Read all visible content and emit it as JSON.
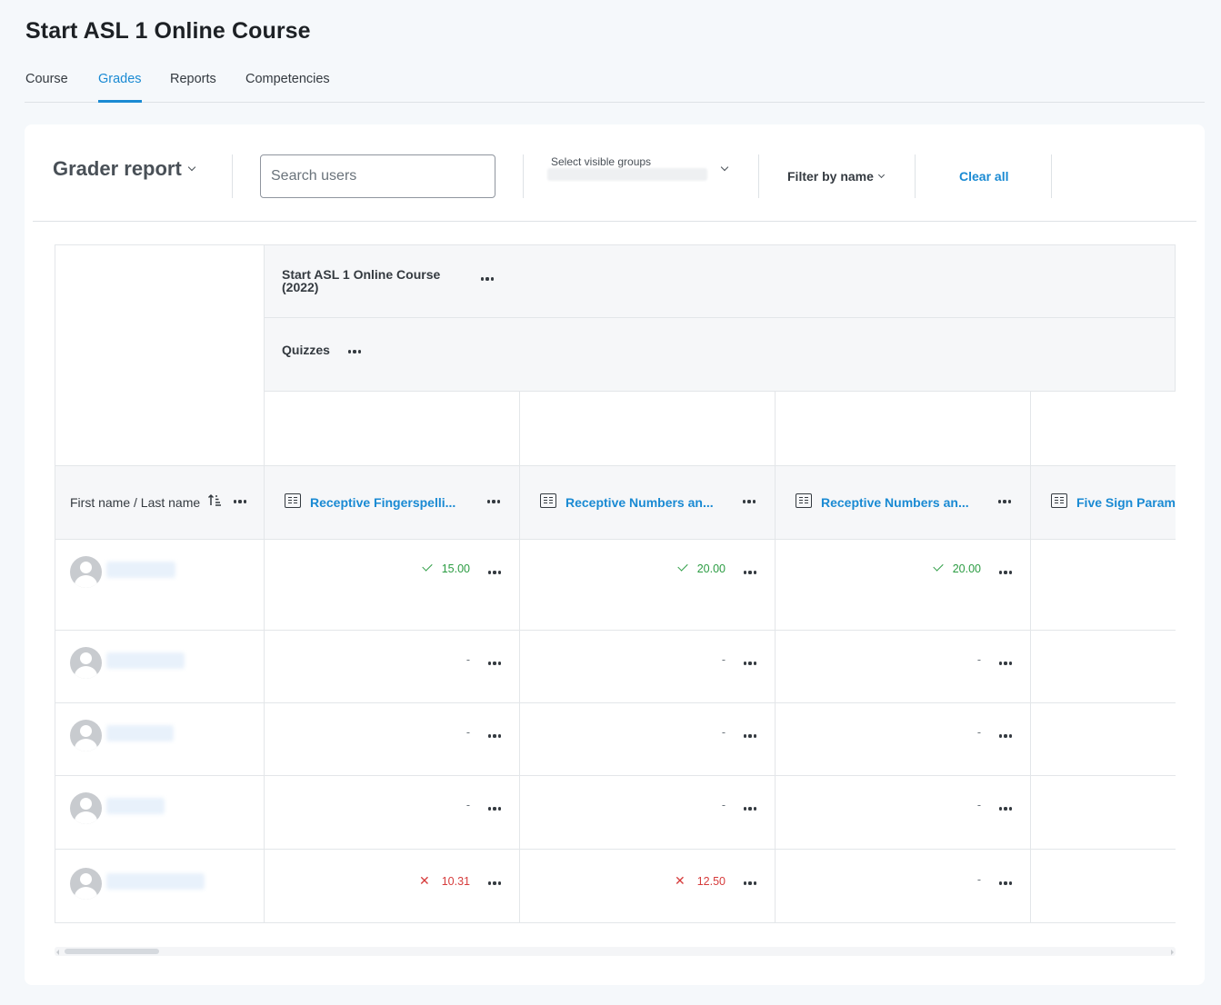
{
  "page": {
    "title": "Start ASL 1 Online Course"
  },
  "tabs": [
    {
      "label": "Course",
      "active": false
    },
    {
      "label": "Grades",
      "active": true
    },
    {
      "label": "Reports",
      "active": false
    },
    {
      "label": "Competencies",
      "active": false
    }
  ],
  "toolbar": {
    "report_title": "Grader report",
    "search_placeholder": "Search users",
    "groups_label": "Select visible groups",
    "filter_label": "Filter by name",
    "clear_label": "Clear all"
  },
  "grid": {
    "category_1": "Start ASL 1 Online Course (2022)",
    "category_2": "Quizzes",
    "name_header": "First name / Last name",
    "columns": [
      "Receptive Fingerspelli...",
      "Receptive Numbers an...",
      "Receptive Numbers an...",
      "Five Sign Param"
    ],
    "rows": [
      {
        "grades": [
          {
            "v": "15.00",
            "s": "pass"
          },
          {
            "v": "20.00",
            "s": "pass"
          },
          {
            "v": "20.00",
            "s": "pass"
          }
        ]
      },
      {
        "grades": [
          {
            "v": "-",
            "s": "none"
          },
          {
            "v": "-",
            "s": "none"
          },
          {
            "v": "-",
            "s": "none"
          }
        ]
      },
      {
        "grades": [
          {
            "v": "-",
            "s": "none"
          },
          {
            "v": "-",
            "s": "none"
          },
          {
            "v": "-",
            "s": "none"
          }
        ]
      },
      {
        "grades": [
          {
            "v": "-",
            "s": "none"
          },
          {
            "v": "-",
            "s": "none"
          },
          {
            "v": "-",
            "s": "none"
          }
        ]
      },
      {
        "grades": [
          {
            "v": "10.31",
            "s": "fail"
          },
          {
            "v": "12.50",
            "s": "fail"
          },
          {
            "v": "-",
            "s": "none"
          }
        ]
      }
    ]
  },
  "colors": {
    "accent": "#1a8ad3",
    "pass": "#2b9c42",
    "fail": "#d63c3c"
  },
  "icons": [
    "chevron-down-icon",
    "more-actions-icon",
    "sort-ascending-icon",
    "grade-item-icon",
    "avatar-icon",
    "check-icon",
    "cross-icon"
  ]
}
